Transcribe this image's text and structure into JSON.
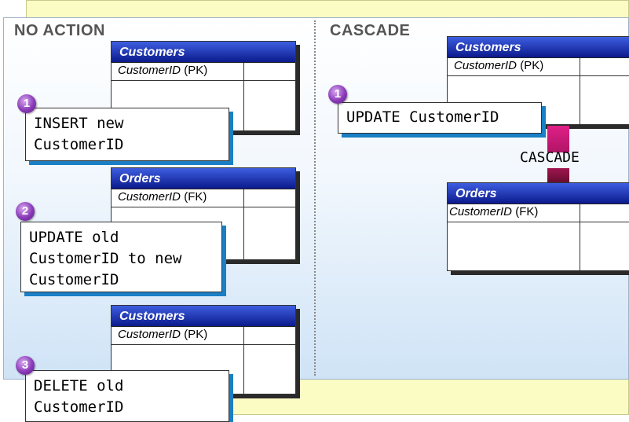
{
  "left_section": {
    "title": "NO ACTION",
    "tables": [
      {
        "name": "Customers",
        "column": "CustomerID",
        "key": "(PK)"
      },
      {
        "name": "Orders",
        "column": "CustomerID",
        "key": "(FK)"
      },
      {
        "name": "Customers",
        "column": "CustomerID",
        "key": "(PK)"
      }
    ],
    "steps": [
      {
        "number": "1",
        "text": "INSERT new\nCustomerID"
      },
      {
        "number": "2",
        "text": "UPDATE old\nCustomerID to new\nCustomerID"
      },
      {
        "number": "3",
        "text": "DELETE old\nCustomerID"
      }
    ]
  },
  "right_section": {
    "title": "CASCADE",
    "tables": [
      {
        "name": "Customers",
        "column": "CustomerID",
        "key": "(PK)"
      },
      {
        "name": "Orders",
        "column": "CustomerID",
        "key": "(FK)"
      }
    ],
    "steps": [
      {
        "number": "1",
        "text": "UPDATE CustomerID"
      }
    ],
    "arrow_label": "CASCADE"
  },
  "colors": {
    "table_header": "#0b1a8c",
    "callout_shadow": "#1a7fc4",
    "badge": "#8a3bb8",
    "arrow": "#7a0f3f",
    "arrow_shaft": "#d81b7a",
    "frame": "#fbfbc4"
  }
}
